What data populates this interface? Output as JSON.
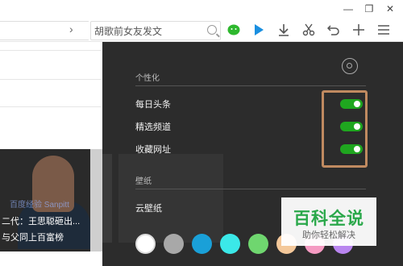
{
  "window": {
    "minimize_icon": "minimize-icon",
    "restore_icon": "restore-icon",
    "close_icon": "close-icon"
  },
  "toolbar": {
    "address_text": "胡歌前女友发文",
    "icons": [
      "wechat-icon",
      "play-icon",
      "download-icon",
      "scissors-icon",
      "undo-icon",
      "plus-icon",
      "menu-icon"
    ]
  },
  "page": {
    "image_watermark": "百度经验 Sanpitt",
    "caption_line1": "二代：王思聪砸出...",
    "caption_line2": "与父同上百富榜"
  },
  "panel": {
    "personalize_title": "个性化",
    "toggles": [
      {
        "label": "每日头条",
        "on": true
      },
      {
        "label": "精选频道",
        "on": true
      },
      {
        "label": "收藏网址",
        "on": true
      }
    ],
    "wallpaper_title": "壁纸",
    "cloud_wallpaper_label": "云壁纸",
    "swatches": [
      "#ffffff",
      "#a8a8a8",
      "#1aa0d8",
      "#3be8e8",
      "#6fd66f",
      "#f4c89a",
      "#f59ac2",
      "#b985f0"
    ],
    "accent_color": "#1fa61f",
    "highlight_color": "#c08a60"
  },
  "watermark": {
    "title": "百科全说",
    "subtitle": "助你轻松解决"
  }
}
